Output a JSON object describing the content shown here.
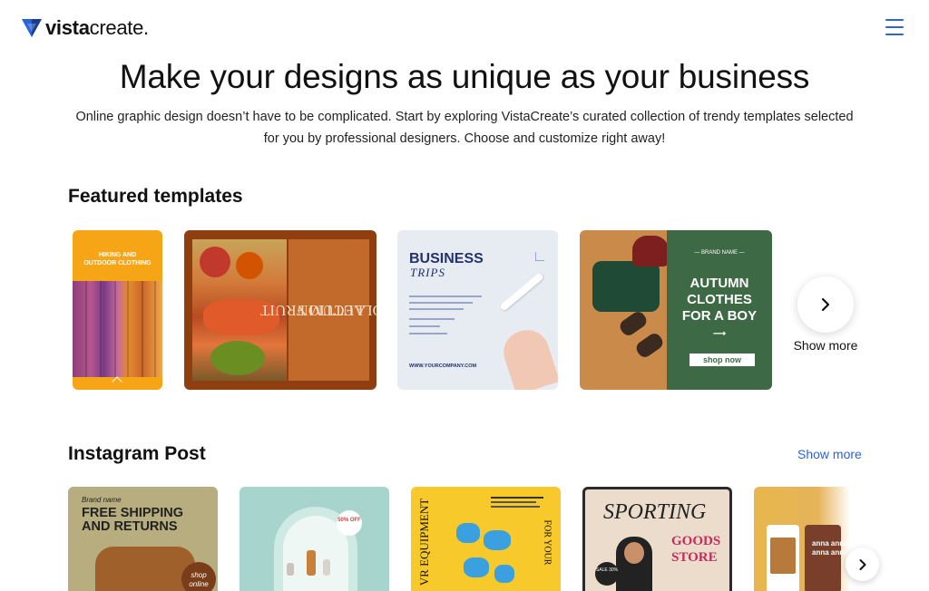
{
  "header": {
    "logo_bold": "vista",
    "logo_light": "create."
  },
  "hero": {
    "title": "Make your designs as unique as your business",
    "subtitle": "Online graphic design doesn’t have to be complicated. Start by exploring VistaCreate’s curated collection of trendy templates selected for you by professional designers. Choose and customize right away!"
  },
  "featured": {
    "title": "Featured templates",
    "show_more_label": "Show more",
    "cards": [
      {
        "line1": "HIKING AND",
        "line2": "OUTDOOR CLOTHING"
      },
      {
        "line1": "AUTUM FRUIT",
        "line2": "COLLECTION"
      },
      {
        "title": "BUSINESS",
        "script": "TRIPS",
        "site": "WWW.YOURCOMPANY.COM"
      },
      {
        "brand": "— BRAND NAME —",
        "line1": "AUTUMN",
        "line2": "CLOTHES",
        "line3": "FOR A BOY",
        "button": "shop now"
      }
    ]
  },
  "instagram": {
    "title": "Instagram Post",
    "show_more_label": "Show more",
    "cards": [
      {
        "brand": "Brand name",
        "line1": "FREE SHIPPING",
        "line2": "AND RETURNS",
        "badge": "shop online"
      },
      {
        "badge": "50% OFF"
      },
      {
        "side": "VR EQUIPMENT",
        "side2": "FOR YOUR"
      },
      {
        "title": "SPORTING",
        "goods1": "GOODS",
        "goods2": "STORE",
        "off": "SALE 30%"
      },
      {
        "text": "anna anna anna anna"
      }
    ]
  },
  "colors": {
    "brand_blue": "#2b63d9",
    "accent_orange": "#f5a516"
  }
}
